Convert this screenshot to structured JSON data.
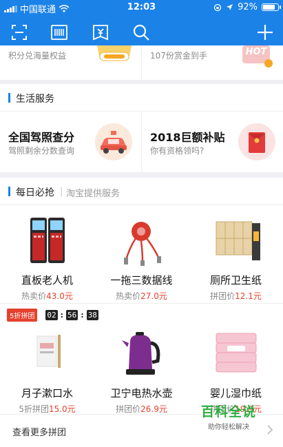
{
  "status_bar": {
    "carrier": "中国联通",
    "time": "12:03",
    "battery": "92%",
    "battery_level": 0.92
  },
  "toolbar": {
    "icons": [
      "scan-icon",
      "barcode-pay-icon",
      "wallet-icon",
      "search-icon",
      "add-icon"
    ]
  },
  "top_card": {
    "left_sub": "积分兑海量权益",
    "right_sub": "107份赏金到手",
    "right_badge": "HOT"
  },
  "life_section": {
    "title": "生活服务",
    "items": [
      {
        "title": "全国驾照查分",
        "subtitle": "驾照剩余分数查询"
      },
      {
        "title": "2018巨额补贴",
        "subtitle": "你有资格领吗?"
      }
    ]
  },
  "daily_section": {
    "title": "每日必抢",
    "separator": "|",
    "subtitle": "淘宝提供服务"
  },
  "products_row1": [
    {
      "name": "直板老人机",
      "price_label": "热卖价",
      "price": "43.0元"
    },
    {
      "name": "一拖三数据线",
      "price_label": "热卖价",
      "price": "27.0元"
    },
    {
      "name": "厕所卫生纸",
      "price_label": "拼团价",
      "price": "12.1元"
    }
  ],
  "flash_sale": {
    "tag": "5折拼团",
    "hours": "02",
    "minutes": "56",
    "seconds": "38"
  },
  "products_row2": [
    {
      "name": "月子漱口水",
      "price_label": "5折拼团",
      "price": "15.0元"
    },
    {
      "name": "卫宁电热水壶",
      "price_label": "拼团价",
      "price": "26.9元"
    },
    {
      "name": "婴儿湿巾纸",
      "price_label": "拼团价",
      "price": "19.9元"
    }
  ],
  "more": {
    "label": "查看更多拼团"
  },
  "watermark": {
    "title": "百科全说",
    "subtitle": "助你轻松解决"
  },
  "colors": {
    "brand_blue": "#1b82e8",
    "price_red": "#e5412d",
    "watermark_green": "#2dae3e"
  }
}
